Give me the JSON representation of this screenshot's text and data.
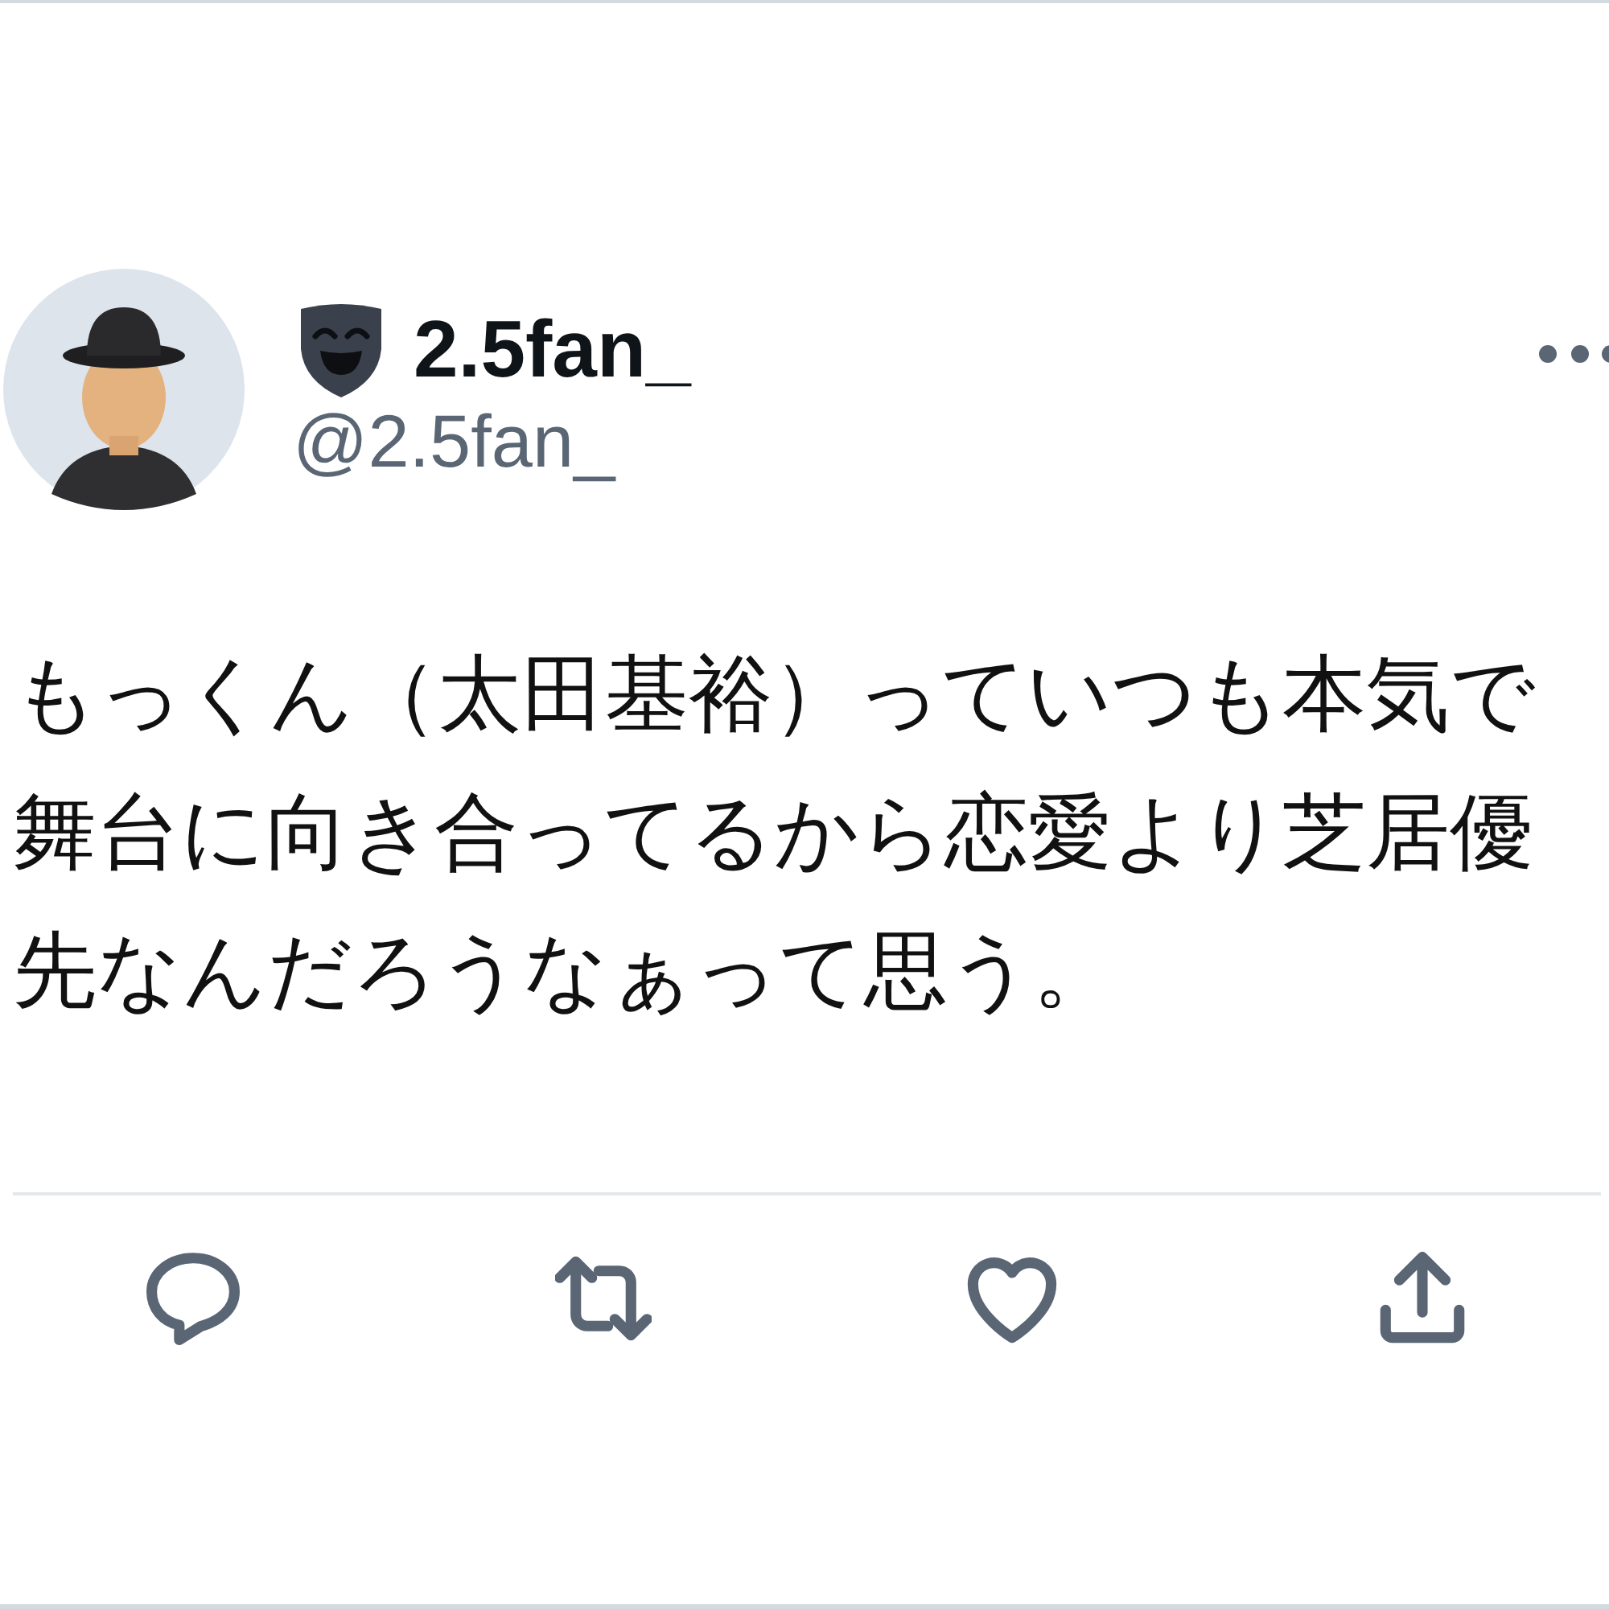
{
  "author": {
    "display_name": "2.5fan_",
    "handle": "@2.5fan_"
  },
  "tweet": {
    "text": "もっくん（太田基裕）っていつも本気で舞台に向き合ってるから恋愛より芝居優先なんだろうなぁって思う。"
  },
  "actions": [
    {
      "kind": "reply"
    },
    {
      "kind": "repost"
    },
    {
      "kind": "like"
    },
    {
      "kind": "share"
    }
  ]
}
